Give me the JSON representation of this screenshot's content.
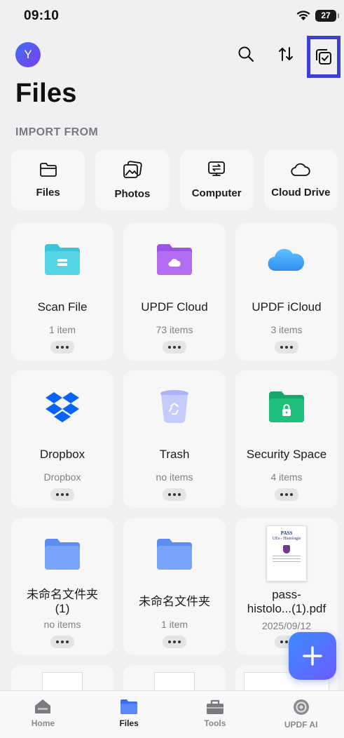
{
  "status_bar": {
    "time": "09:10",
    "battery": "27"
  },
  "header": {
    "avatar_letter": "Y",
    "title": "Files"
  },
  "import": {
    "section_label": "IMPORT FROM",
    "items": [
      {
        "label": "Files",
        "icon": "folder-outline-icon"
      },
      {
        "label": "Photos",
        "icon": "photos-icon"
      },
      {
        "label": "Computer",
        "icon": "computer-transfer-icon"
      },
      {
        "label": "Cloud Drive",
        "icon": "cloud-outline-icon"
      }
    ]
  },
  "grid": {
    "items": [
      {
        "name": "Scan File",
        "meta": "1 item",
        "icon": "scan-folder-icon"
      },
      {
        "name": "UPDF Cloud",
        "meta": "73 items",
        "icon": "updf-cloud-folder-icon"
      },
      {
        "name": "UPDF iCloud",
        "meta": "3 items",
        "icon": "icloud-icon"
      },
      {
        "name": "Dropbox",
        "meta": "Dropbox",
        "icon": "dropbox-icon"
      },
      {
        "name": "Trash",
        "meta": "no items",
        "icon": "trash-icon"
      },
      {
        "name": "Security Space",
        "meta": "4 items",
        "icon": "security-folder-icon"
      },
      {
        "name": "未命名文件夹\n(1)",
        "meta": "no items",
        "icon": "folder-icon"
      },
      {
        "name": "未命名文件夹",
        "meta": "1 item",
        "icon": "folder-icon"
      },
      {
        "name": "pass-\nhistolo...(1).pdf",
        "meta": "2025/09/12",
        "icon": "pdf-thumbnail"
      }
    ],
    "pdf_thumb": {
      "title": "PASS",
      "subtitle": "UEs - Histologie"
    }
  },
  "tabbar": {
    "items": [
      {
        "label": "Home",
        "icon": "home-icon"
      },
      {
        "label": "Files",
        "icon": "files-icon",
        "active": true
      },
      {
        "label": "Tools",
        "icon": "tools-icon"
      },
      {
        "label": "UPDF AI",
        "icon": "updf-ai-icon"
      }
    ]
  },
  "colors": {
    "highlight": "#3b3fd6",
    "fab": "#4a7bff"
  }
}
